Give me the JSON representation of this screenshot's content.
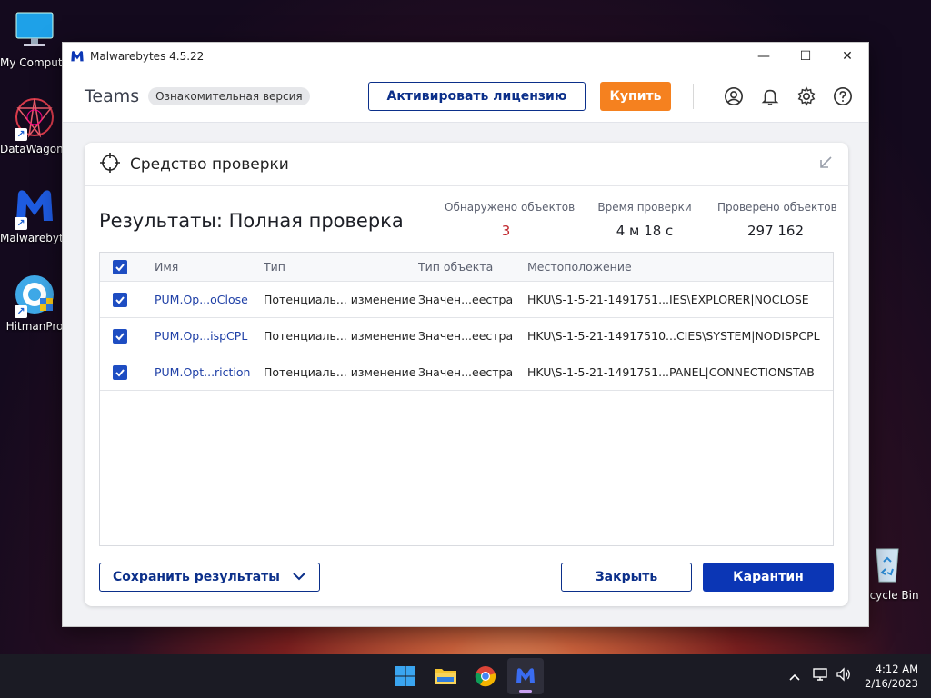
{
  "desktop": {
    "icons": [
      {
        "label": "My Computer"
      },
      {
        "label": "DataWagon..."
      },
      {
        "label": "Malwarebytes"
      },
      {
        "label": "HitmanPro"
      },
      {
        "label": "Recycle Bin"
      }
    ]
  },
  "window": {
    "title": "Malwarebytes 4.5.22",
    "controls": {
      "minimize": "—",
      "maximize": "☐",
      "close": "✕"
    }
  },
  "header": {
    "product": "Teams",
    "edition_badge": "Ознакомительная версия",
    "activate_label": "Активировать лицензию",
    "buy_label": "Купить",
    "icons": [
      "account-icon",
      "bell-icon",
      "gear-icon",
      "help-icon"
    ]
  },
  "panel": {
    "title": "Средство проверки",
    "results_title": "Результаты: Полная проверка",
    "stats": [
      {
        "label": "Обнаружено объектов",
        "value": "3"
      },
      {
        "label": "Время проверки",
        "value": "4 м 18 с"
      },
      {
        "label": "Проверено объектов",
        "value": "297 162"
      }
    ],
    "table": {
      "columns": [
        "Имя",
        "Тип",
        "Тип объекта",
        "Местоположение"
      ],
      "rows": [
        {
          "name": "PUM.Op...oClose",
          "type": "Потенциаль... изменение",
          "object_type": "Значен...еестра",
          "location": "HKU\\S-1-5-21-1491751...IES\\EXPLORER|NOCLOSE"
        },
        {
          "name": "PUM.Op...ispCPL",
          "type": "Потенциаль... изменение",
          "object_type": "Значен...еестра",
          "location": "HKU\\S-1-5-21-14917510...CIES\\SYSTEM|NODISPCPL"
        },
        {
          "name": "PUM.Opt...riction",
          "type": "Потенциаль... изменение",
          "object_type": "Значен...еестра",
          "location": "HKU\\S-1-5-21-1491751...PANEL|CONNECTIONSTAB"
        }
      ]
    },
    "save_label": "Сохранить результаты",
    "close_label": "Закрыть",
    "quarantine_label": "Карантин"
  },
  "taskbar": {
    "apps": [
      "start-icon",
      "file-explorer-icon",
      "chrome-icon",
      "malwarebytes-icon"
    ],
    "time": "4:12 AM",
    "date": "2/16/2023"
  },
  "colors": {
    "accent_navy": "#0b2f8a",
    "accent_blue": "#0b36b5",
    "buy_orange": "#f5811f",
    "detected_red": "#c0272d"
  }
}
